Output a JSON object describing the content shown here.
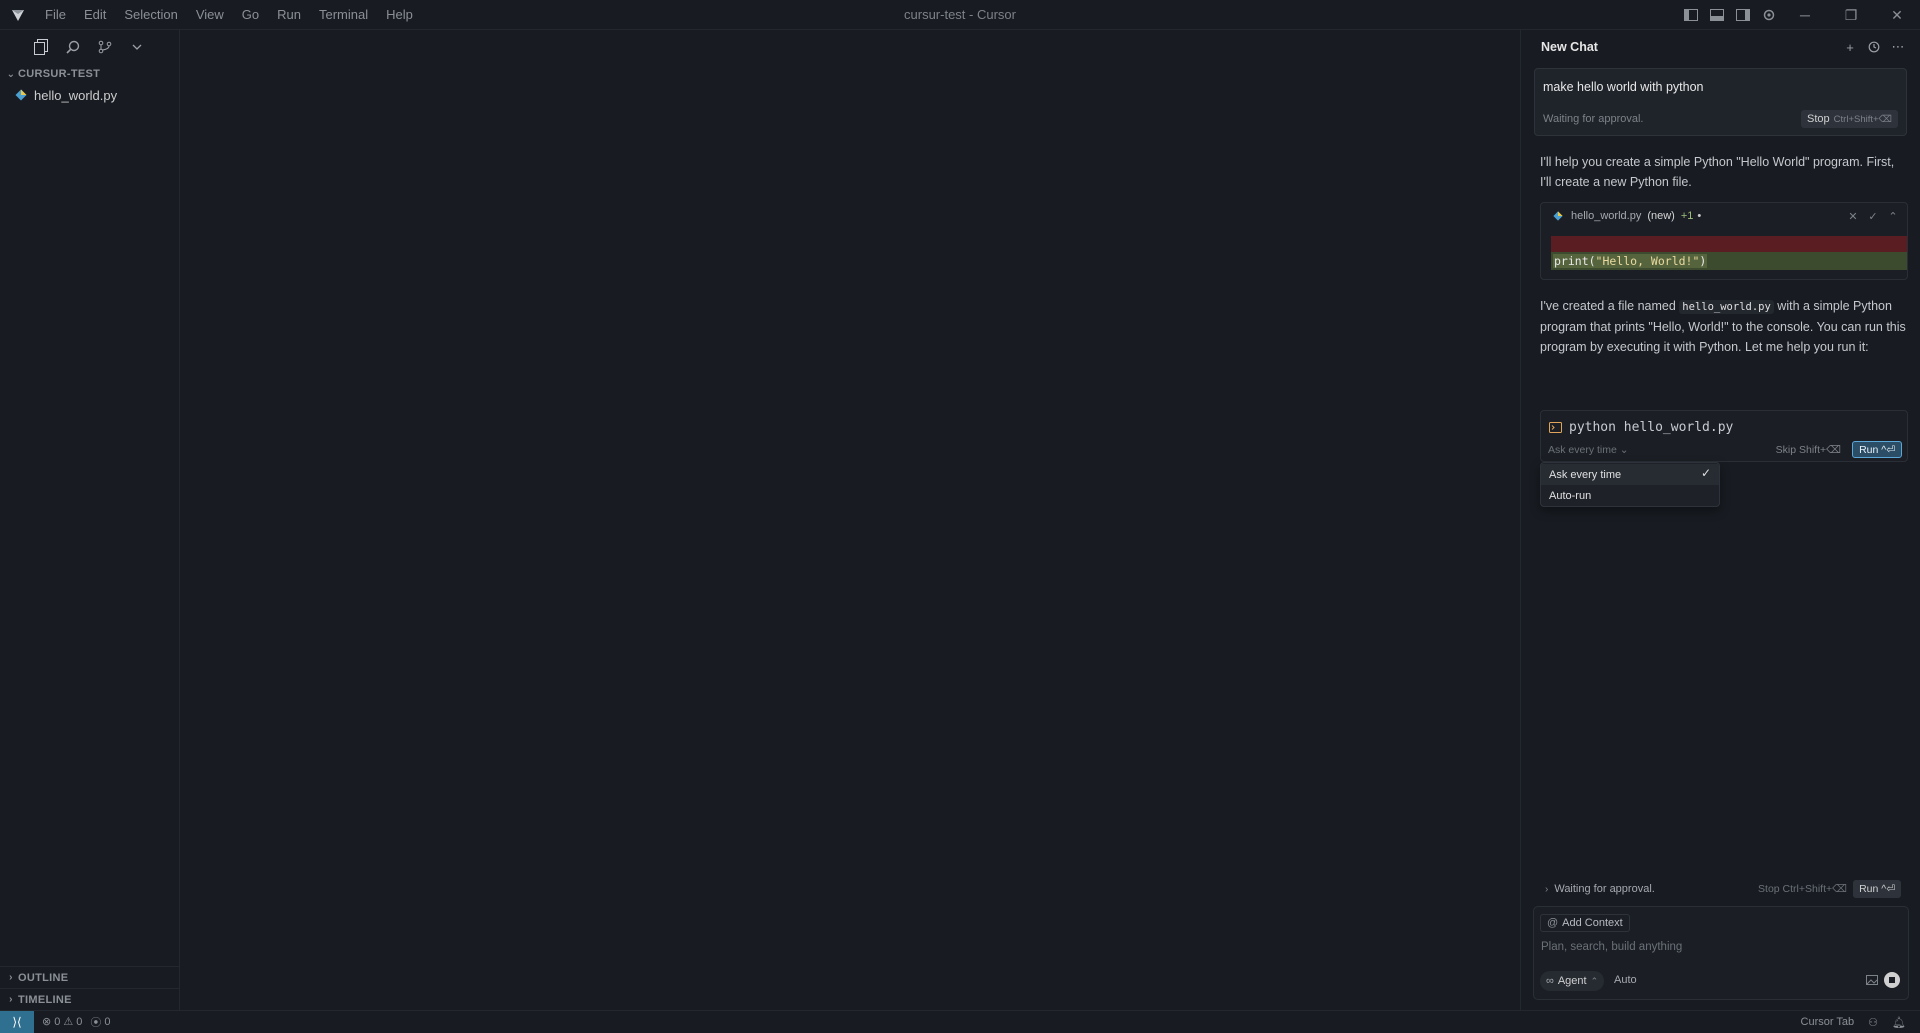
{
  "window": {
    "title": "cursur-test - Cursor",
    "menu": [
      "File",
      "Edit",
      "Selection",
      "View",
      "Go",
      "Run",
      "Terminal",
      "Help"
    ]
  },
  "sidebar": {
    "folder": "CURSUR-TEST",
    "files": [
      "hello_world.py"
    ],
    "bottom_sections": [
      "OUTLINE",
      "TIMELINE"
    ]
  },
  "chat": {
    "title": "New Chat",
    "query": "make hello world with python",
    "query_status": "Waiting for approval.",
    "stop_label": "Stop",
    "stop_shortcut": "Ctrl+Shift+⌫",
    "message1": "I'll help you create a simple Python \"Hello World\" program. First, I'll create a new Python file.",
    "code_card": {
      "filename": "hello_world.py",
      "tag": "(new)",
      "changes": "+1",
      "dot": "•",
      "code_prefix": "print(",
      "code_string": "\"Hello, World!\"",
      "code_suffix": ")"
    },
    "message2_before": "I've created a file named",
    "message2_code": "hello_world.py",
    "message2_after": "with a simple Python program that prints \"Hello, World!\" to the console. You can run this program by executing it with Python. Let me help you run it:",
    "terminal": {
      "command": "python hello_world.py",
      "mode": "Ask every time",
      "skip_label": "Skip Shift+⌫",
      "run_label": "Run ^⏎"
    },
    "dropdown": {
      "options": [
        "Ask every time",
        "Auto-run"
      ],
      "selected": "Ask every time"
    },
    "bottom_status": {
      "text": "Waiting for approval.",
      "stop": "Stop Ctrl+Shift+⌫",
      "run": "Run ^⏎"
    },
    "composer": {
      "add_context": "Add Context",
      "placeholder": "Plan, search, build anything",
      "agent_label": "Agent",
      "model_label": "Auto"
    }
  },
  "statusbar": {
    "errors": "0",
    "warnings": "0",
    "ports": "0",
    "cursor_tab": "Cursor Tab"
  }
}
